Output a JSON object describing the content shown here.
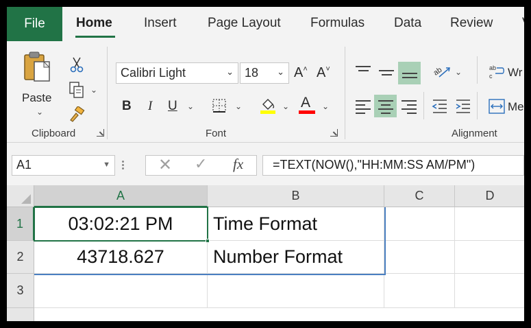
{
  "tabs": {
    "file": "File",
    "home": "Home",
    "insert": "Insert",
    "page_layout": "Page Layout",
    "formulas": "Formulas",
    "data": "Data",
    "review": "Review",
    "view": "V"
  },
  "ribbon": {
    "clipboard": {
      "label": "Clipboard",
      "paste_label": "Paste",
      "paste_icon": "paste-icon",
      "cut_icon": "scissors-icon",
      "copy_icon": "copy-icon",
      "format_painter_icon": "paintbrush-icon"
    },
    "font": {
      "label": "Font",
      "font_name": "Calibri Light",
      "font_size": "18",
      "bold": "B",
      "italic": "I",
      "underline": "U",
      "font_color_letter": "A",
      "grow_letter": "A",
      "shrink_letter": "A"
    },
    "alignment": {
      "label": "Alignment",
      "wrap_label": "Wr",
      "merge_label": "Me"
    }
  },
  "formula_bar": {
    "name_box": "A1",
    "fx": "fx",
    "formula": "=TEXT(NOW(),\"HH:MM:SS AM/PM\")"
  },
  "sheet": {
    "columns": [
      "A",
      "B",
      "C",
      "D"
    ],
    "rows": [
      "1",
      "2",
      "3"
    ],
    "cells": {
      "A1": "03:02:21 PM",
      "B1": "Time Format",
      "A2": "43718.627",
      "B2": "Number Format"
    },
    "active_cell": "A1"
  },
  "colors": {
    "accent": "#217346",
    "highlight": "#a9d0b6",
    "fill_yellow": "#ffff00",
    "font_red": "#ff0000",
    "range_blue": "#4a7fc1"
  }
}
